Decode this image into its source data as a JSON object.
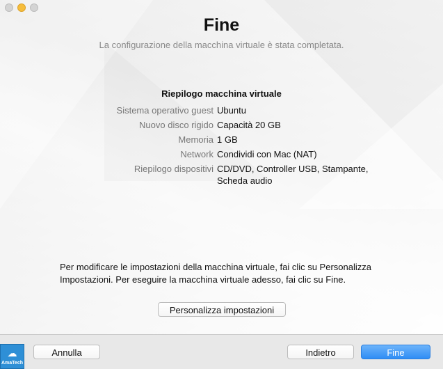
{
  "window": {
    "traffic_lights": [
      "close",
      "minimize",
      "zoom"
    ]
  },
  "header": {
    "title": "Fine",
    "subtitle": "La configurazione della macchina virtuale è stata completata."
  },
  "summary": {
    "heading": "Riepilogo macchina virtuale",
    "rows": [
      {
        "label": "Sistema operativo guest",
        "value": "Ubuntu"
      },
      {
        "label": "Nuovo disco rigido",
        "value": "Capacità 20 GB"
      },
      {
        "label": "Memoria",
        "value": "1 GB"
      },
      {
        "label": "Network",
        "value": "Condividi con Mac (NAT)"
      },
      {
        "label": "Riepilogo dispositivi",
        "value": "CD/DVD, Controller USB, Stampante, Scheda audio"
      }
    ]
  },
  "help_text": "Per modificare le impostazioni della macchina virtuale, fai clic su Personalizza Impostazioni. Per eseguire la macchina virtuale adesso, fai clic su Fine.",
  "buttons": {
    "customize": "Personalizza impostazioni",
    "cancel": "Annulla",
    "back": "Indietro",
    "finish": "Fine"
  },
  "brand": {
    "icon": "cloud-upload-icon",
    "text": "AmaTech"
  },
  "colors": {
    "accent": "#2f8df5",
    "minimize_light": "#f6bd3c",
    "brand": "#2e8fd6"
  }
}
